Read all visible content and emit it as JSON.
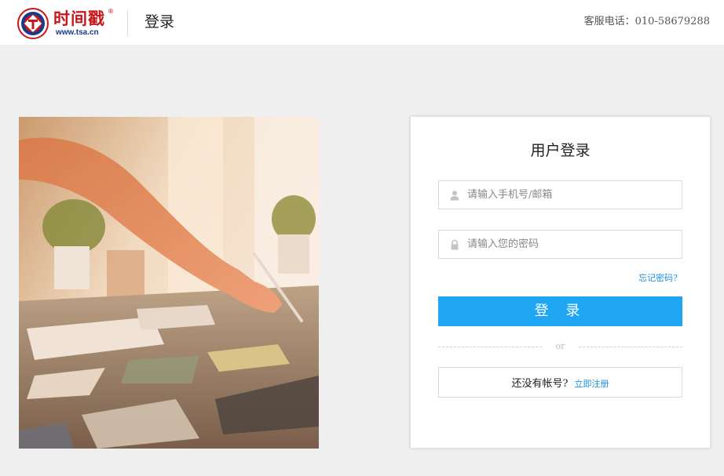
{
  "header": {
    "logo_name": "时间戳",
    "logo_registered": "®",
    "logo_url": "www.tsa.cn",
    "page_title": "登录",
    "hotline": "客服电话：010-58679288"
  },
  "login": {
    "title": "用户登录",
    "username_placeholder": "请输入手机号/邮箱",
    "username_value": "",
    "password_placeholder": "请输入您的密码",
    "password_value": "",
    "username_icon": "user-icon",
    "password_icon": "lock-icon",
    "forgot_label": "忘记密码?",
    "submit_label": "登 录",
    "divider_text": "or",
    "register_prompt": "还没有帐号?",
    "register_link": "立即注册"
  },
  "colors": {
    "accent": "#1ea6f3",
    "link": "#1a8fe3",
    "brand_red": "#c8161d",
    "page_bg": "#efefef"
  }
}
